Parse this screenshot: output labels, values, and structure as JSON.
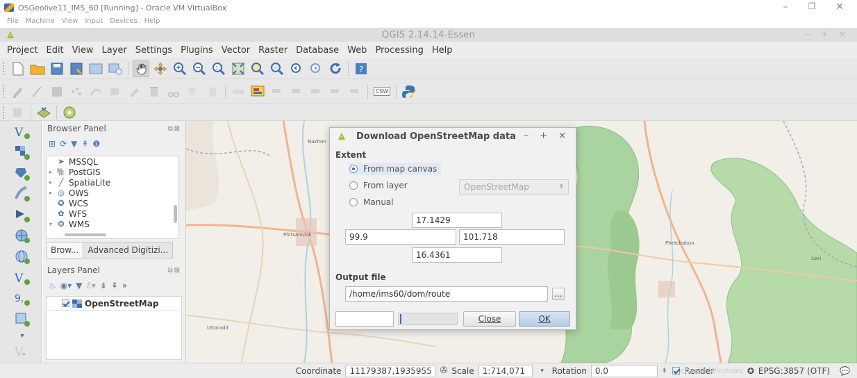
{
  "host": {
    "title": "OSGeolive11_IMS_60 [Running] - Oracle VM VirtualBox",
    "menu": [
      "File",
      "Machine",
      "View",
      "Input",
      "Devices",
      "Help"
    ]
  },
  "app": {
    "title": "QGIS 2.14.14-Essen",
    "menu": [
      "Project",
      "Edit",
      "View",
      "Layer",
      "Settings",
      "Plugins",
      "Vector",
      "Raster",
      "Database",
      "Web",
      "Processing",
      "Help"
    ],
    "csw_label": "CSW"
  },
  "browser_panel": {
    "title": "Browser Panel",
    "items": [
      {
        "label": "MSSQL",
        "icon": "mssql-icon"
      },
      {
        "label": "PostGIS",
        "icon": "postgis-icon"
      },
      {
        "label": "SpatiaLite",
        "icon": "spatialite-icon"
      },
      {
        "label": "OWS",
        "icon": "ows-icon"
      },
      {
        "label": "WCS",
        "icon": "wcs-icon"
      },
      {
        "label": "WFS",
        "icon": "wfs-icon"
      },
      {
        "label": "WMS",
        "icon": "wms-icon"
      }
    ],
    "tabs": [
      "Brow...",
      "Advanced Digitizi..."
    ]
  },
  "layers_panel": {
    "title": "Layers Panel",
    "layers": [
      {
        "name": "OpenStreetMap",
        "checked": true
      }
    ]
  },
  "dialog": {
    "title": "Download OpenStreetMap data",
    "extent_label": "Extent",
    "radio_map_canvas": "From map canvas",
    "radio_layer": "From layer",
    "radio_manual": "Manual",
    "selected": "From map canvas",
    "layer_combo": "OpenStreetMap",
    "north": "17.1429",
    "west": "99.9",
    "east": "101.718",
    "south": "16.4361",
    "output_label": "Output file",
    "output_path": "/home/ims60/dom/route",
    "browse_label": "...",
    "close_label": "Close",
    "ok_label": "OK"
  },
  "map": {
    "labels": [
      "Nakhon",
      "Phitsanulok",
      "Phetchabun",
      "Uttaradit",
      "Loei"
    ]
  },
  "status": {
    "coordinate_label": "Coordinate",
    "coordinate_value": "11179387,1935955",
    "scale_label": "Scale",
    "scale_value": "1:714,071",
    "rotation_label": "Rotation",
    "rotation_value": "0.0",
    "render_label": "Render",
    "crs": "EPSG:3857 (OTF)",
    "watermark": "Activate Windows"
  },
  "colors": {
    "forest": "#8bc08a",
    "road": "#f4b38b",
    "accent": "#3a6fb0"
  }
}
